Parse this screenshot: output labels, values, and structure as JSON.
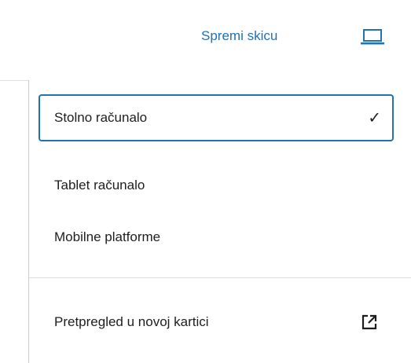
{
  "toolbar": {
    "save_draft_label": "Spremi skicu",
    "device_icon": "laptop-icon",
    "accent_color": "#2271b1"
  },
  "preview_menu": {
    "items": [
      {
        "label": "Stolno računalo",
        "selected": true,
        "icon": "check-icon"
      },
      {
        "label": "Tablet računalo",
        "selected": false
      },
      {
        "label": "Mobilne platforme",
        "selected": false
      }
    ],
    "new_tab_item": {
      "label": "Pretpregled u novoj kartici",
      "icon": "external-link-icon"
    },
    "check_glyph": "✓"
  }
}
